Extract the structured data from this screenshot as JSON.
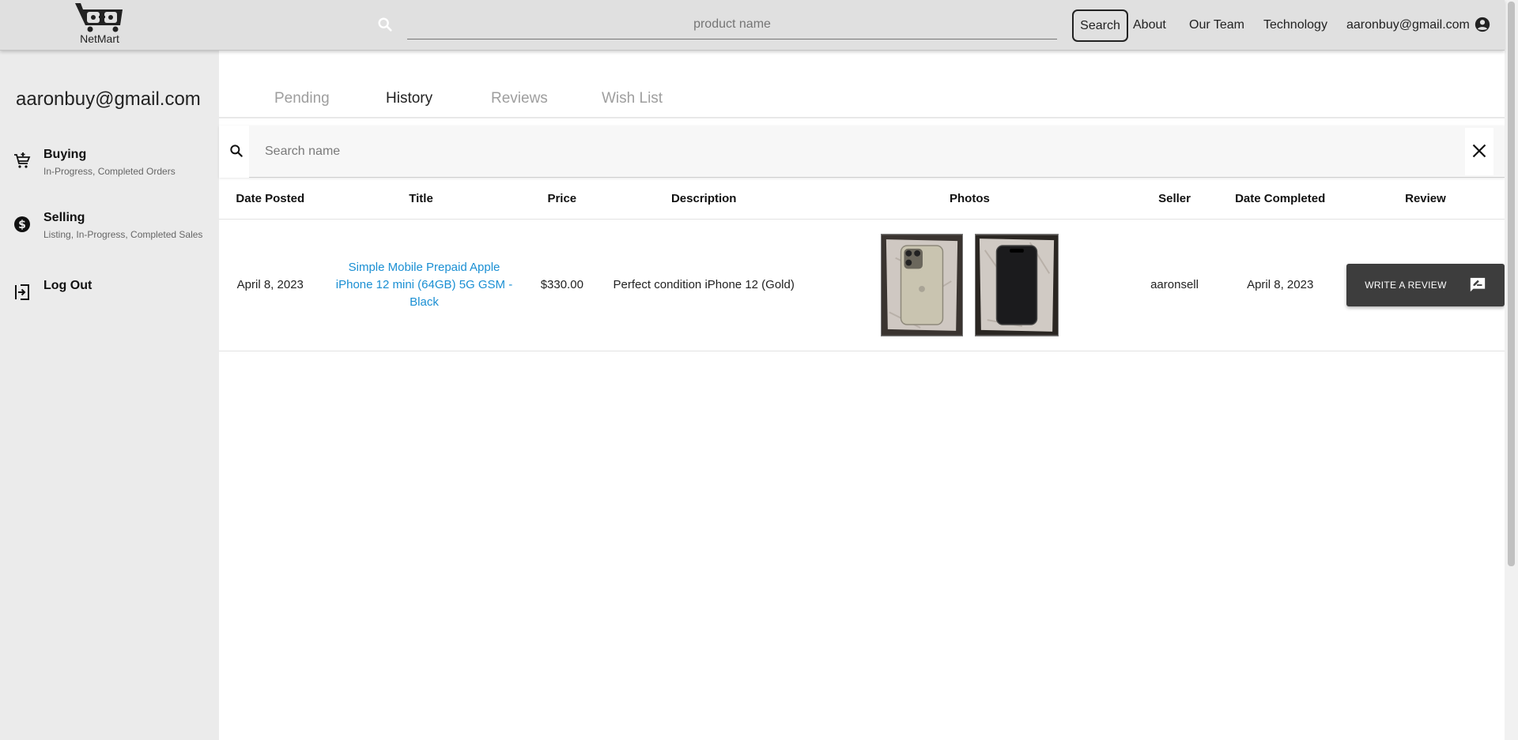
{
  "header": {
    "logo_text": "NetMart",
    "search_placeholder": "product name",
    "search_button": "Search",
    "nav": [
      "About",
      "Our Team",
      "Technology",
      "aaronbuy@gmail.com"
    ]
  },
  "sidebar": {
    "email": "aaronbuy@gmail.com",
    "items": [
      {
        "label": "Buying",
        "sub": "In-Progress, Completed Orders",
        "icon": "cart-add-icon"
      },
      {
        "label": "Selling",
        "sub": "Listing, In-Progress, Completed Sales",
        "icon": "dollar-circle-icon"
      },
      {
        "label": "Log Out",
        "sub": "",
        "icon": "logout-icon"
      }
    ]
  },
  "tabs": [
    "Pending",
    "History",
    "Reviews",
    "Wish List"
  ],
  "active_tab": "History",
  "table": {
    "search_placeholder": "Search name",
    "columns": [
      "Date Posted",
      "Title",
      "Price",
      "Description",
      "Photos",
      "Seller",
      "Date Completed",
      "Review"
    ],
    "rows": [
      {
        "date_posted": "April 8, 2023",
        "title": "Simple Mobile Prepaid Apple iPhone 12 mini (64GB) 5G GSM - Black",
        "price": "$330.00",
        "description": "Perfect condition iPhone 12 (Gold)",
        "photos": [
          "phone-back-photo",
          "phone-front-photo"
        ],
        "seller": "aaronsell",
        "date_completed": "April 8, 2023",
        "review_button": "Write a review"
      }
    ]
  },
  "colors": {
    "topbar": "#e0e0e0",
    "sidebar": "#ebebeb",
    "link": "#1a8fd3",
    "review_button": "#3d3d3d",
    "tab_inactive": "#9e9e9e"
  }
}
